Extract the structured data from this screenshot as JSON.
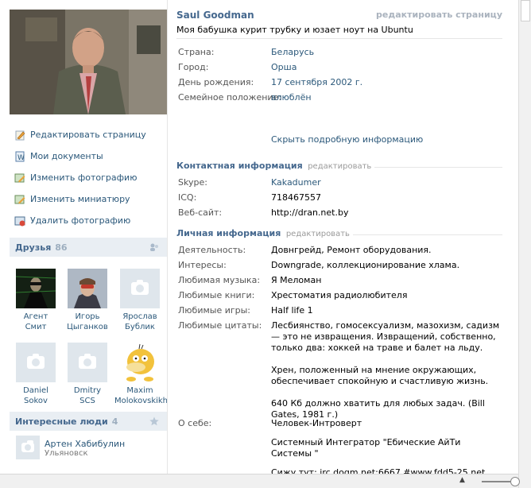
{
  "profile": {
    "name": "Saul Goodman",
    "edit_page_link": "редактировать страницу",
    "status": "Моя бабушка курит трубку и юзает ноут на Ubuntu"
  },
  "left_actions": [
    {
      "label": "Редактировать страницу",
      "icon": "pencil-icon"
    },
    {
      "label": "Мои документы",
      "icon": "document-icon"
    },
    {
      "label": "Изменить фотографию",
      "icon": "edit-photo-icon"
    },
    {
      "label": "Изменить миниатюру",
      "icon": "edit-thumbnail-icon"
    },
    {
      "label": "Удалить фотографию",
      "icon": "delete-photo-icon"
    }
  ],
  "friends": {
    "title": "Друзья",
    "count": "86",
    "items": [
      {
        "first": "Агент",
        "last": "Смит"
      },
      {
        "first": "Игорь",
        "last": "Цыганков"
      },
      {
        "first": "Ярослав",
        "last": "Бублик"
      },
      {
        "first": "Daniel",
        "last": "Sokov"
      },
      {
        "first": "Dmitry",
        "last": "SCS"
      },
      {
        "first": "Maxim",
        "last": "Molokovskikh"
      }
    ]
  },
  "interesting": {
    "title": "Интересные люди",
    "count": "4",
    "items": [
      {
        "name": "Артен Хабибулин",
        "city": "Ульяновск"
      }
    ]
  },
  "basic_info": [
    {
      "key": "Страна:",
      "value": "Беларусь"
    },
    {
      "key": "Город:",
      "value": "Орша"
    },
    {
      "key": "День рождения:",
      "value": "17 сентября 2002 г."
    },
    {
      "key": "Семейное положение:",
      "value": "влюблён"
    }
  ],
  "more_info_link": "Скрыть подробную информацию",
  "contact": {
    "title": "Контактная информация",
    "edit": "редактировать",
    "rows": [
      {
        "key": "Skype:",
        "value": "Kakadumer"
      },
      {
        "key": "ICQ:",
        "value": "718467557"
      },
      {
        "key": "Веб-сайт:",
        "value": "http://dran.net.by"
      }
    ]
  },
  "personal": {
    "title": "Личная информация",
    "edit": "редактировать",
    "rows": [
      {
        "key": "Деятельность:",
        "value": "Довнгрейд, Ремонт оборудования."
      },
      {
        "key": "Интересы:",
        "value": "Downgrade, коллекционирование хлама."
      },
      {
        "key": "Любимая музыка:",
        "value": "Я Меломан"
      },
      {
        "key": "Любимые книги:",
        "value": "Хрестоматия радиолюбителя"
      },
      {
        "key": "Любимые игры:",
        "value": "Half life 1"
      },
      {
        "key": "Любимые цитаты:",
        "quote1": "Лесбиянство, гомосексуализм, мазохизм, садизм — это не извращения. Извращений, собственно, только два: хоккей на траве и балет на льду.",
        "quote2": "Хрен, положенный на мнение окружающих, обеспечивает спокойную и счастливую жизнь.",
        "quote3": "640 Кб должно хватить для любых задач. (Bill Gates, 1981 г.)"
      },
      {
        "key": "О себе:",
        "about1": "Человек-Интроверт",
        "about2": "Системный Интегратор \"Ебические АйТи Системы \"",
        "about3": "Сижу тут: irc.dogm.net:6667 #www.fdd5-25.net"
      }
    ]
  },
  "colors": {
    "link": "#2b587a",
    "header": "#45688e",
    "section_bg": "#e9eef3"
  }
}
